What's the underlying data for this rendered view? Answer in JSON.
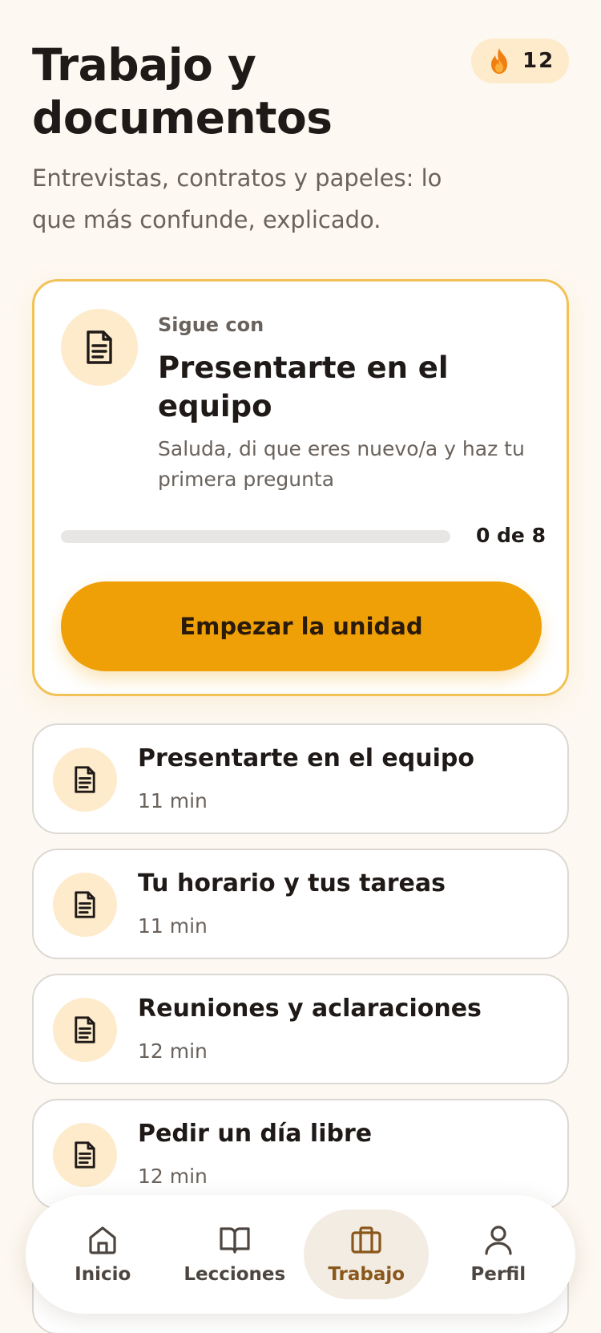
{
  "header": {
    "title": "Trabajo y documentos",
    "subtitle": "Entrevistas, contratos y papeles: lo que más confunde, explicado.",
    "streak": {
      "icon": "flame-icon",
      "count": "12"
    }
  },
  "featured": {
    "icon": "document-icon",
    "eyebrow": "Sigue con",
    "title": "Presentarte en el equipo",
    "description": "Saluda, di que eres nuevo/a y haz tu primera pregunta",
    "progress": {
      "completed": 0,
      "total": 8,
      "label": "0 de 8"
    },
    "cta_label": "Empezar la unidad"
  },
  "lessons": [
    {
      "title": "Presentarte en el equipo",
      "duration": "11 min",
      "icon": "document-icon"
    },
    {
      "title": "Tu horario y tus tareas",
      "duration": "11 min",
      "icon": "document-icon"
    },
    {
      "title": "Reuniones y aclaraciones",
      "duration": "12 min",
      "icon": "document-icon"
    },
    {
      "title": "Pedir un día libre",
      "duration": "12 min",
      "icon": "document-icon"
    }
  ],
  "nav": {
    "items": [
      {
        "label": "Inicio",
        "icon": "home-icon",
        "active": false
      },
      {
        "label": "Lecciones",
        "icon": "book-icon",
        "active": false
      },
      {
        "label": "Trabajo",
        "icon": "briefcase-icon",
        "active": true
      },
      {
        "label": "Perfil",
        "icon": "user-icon",
        "active": false
      }
    ]
  },
  "colors": {
    "background": "#fdf8f1",
    "accent": "#f0a007",
    "accent_soft": "#fdebcc",
    "card_border": "#f2c257",
    "active_nav": "#8a571a"
  }
}
